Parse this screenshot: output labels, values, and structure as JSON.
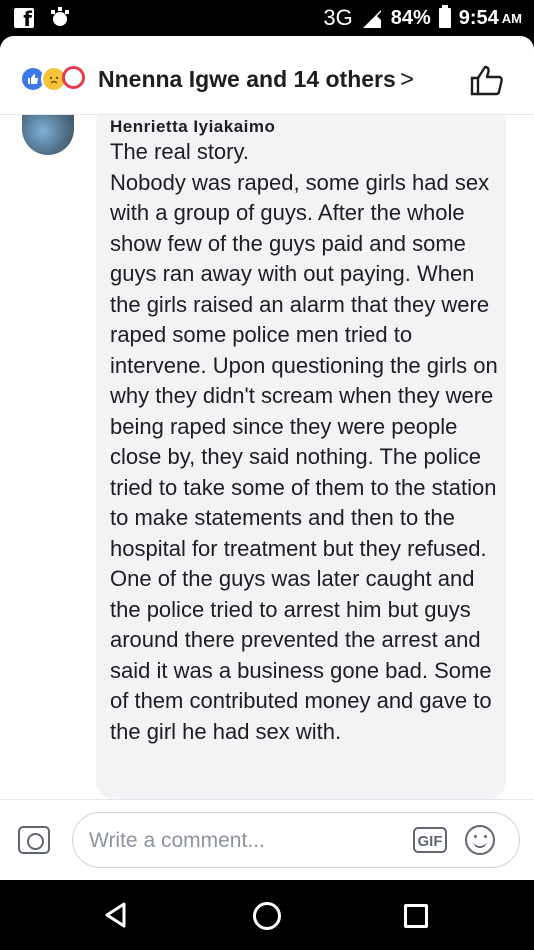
{
  "status_bar": {
    "network": "3G",
    "battery": "84%",
    "time": "9:54",
    "ampm": "AM"
  },
  "header": {
    "likers": "Nnenna Igwe and 14 others",
    "chevron": ">"
  },
  "comment": {
    "author": "Henrietta Iyiakaimo",
    "lines": [
      "The real story.",
      "Nobody was raped, some girls had sex with a group of guys. After the whole show few of the guys paid and some guys ran away with out paying. When the girls raised an alarm that they were raped some police men tried to intervene. Upon questioning the girls on why they didn't scream when they were being raped since they were people close by, they said nothing. The police tried to take some of them to the station to make statements and then to the hospital for treatment but they refused. One of the guys was later caught and the police tried to arrest him but guys around there prevented the arrest and said it was a business gone bad. Some of them contributed money and gave to the girl he had sex with."
    ]
  },
  "composer": {
    "placeholder": "Write a comment...",
    "gif_label": "GIF"
  },
  "colors": {
    "like_blue": "#3b78e7",
    "love_red": "#e83a4f",
    "sad_yellow": "#f5c33b"
  }
}
